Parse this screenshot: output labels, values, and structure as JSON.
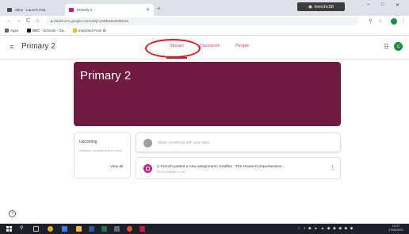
{
  "browser": {
    "tabs": [
      {
        "title": "Slton - Launch Pad",
        "favicon_color": "#4a4a4a"
      },
      {
        "title": "Primary 2",
        "favicon_color": "#d01884"
      }
    ],
    "new_tab": "+",
    "profile": "frenchc58",
    "window_controls": {
      "minimize": "–",
      "maximize": "□",
      "close": "✕"
    },
    "nav": {
      "back": "←",
      "forward": "→",
      "reload": "C",
      "home": "⌂"
    },
    "url": "classroom.google.com/c/MjYyNDMxNzE0MzZa",
    "bookmarks": [
      {
        "label": "Apps",
        "color": "#5f6368"
      },
      {
        "label": "BBC - Schools - Ga...",
        "color": "#1a1a1a"
      },
      {
        "label": "Imported From IE",
        "color": "#f4c20d"
      }
    ]
  },
  "classroom": {
    "class_name": "Primary 2",
    "tabs": [
      "Stream",
      "Classwork",
      "People"
    ],
    "active_tab": "Stream",
    "avatar_initial": "c",
    "banner_title": "Primary 2",
    "upcoming": {
      "title": "Upcoming",
      "text": "Woohoo, no work due in soon!",
      "view_all": "View all"
    },
    "share_placeholder": "Share something with your class...",
    "post": {
      "title": "C French posted a new assignment: Giraffes - The House Comprehension",
      "time": "09:44 (Edited 11:18)"
    },
    "help": "?"
  },
  "taskbar": {
    "tray_icons": "⌂ ◑ ◆ ▲ ▲ ◆ ◆ ◆ ◆ ◆",
    "clock_time": "12:27",
    "clock_date": "17/06/2021"
  },
  "colors": {
    "accent": "#a3245f",
    "banner": "#701b3d",
    "annotation_circle": "#e0161f"
  }
}
